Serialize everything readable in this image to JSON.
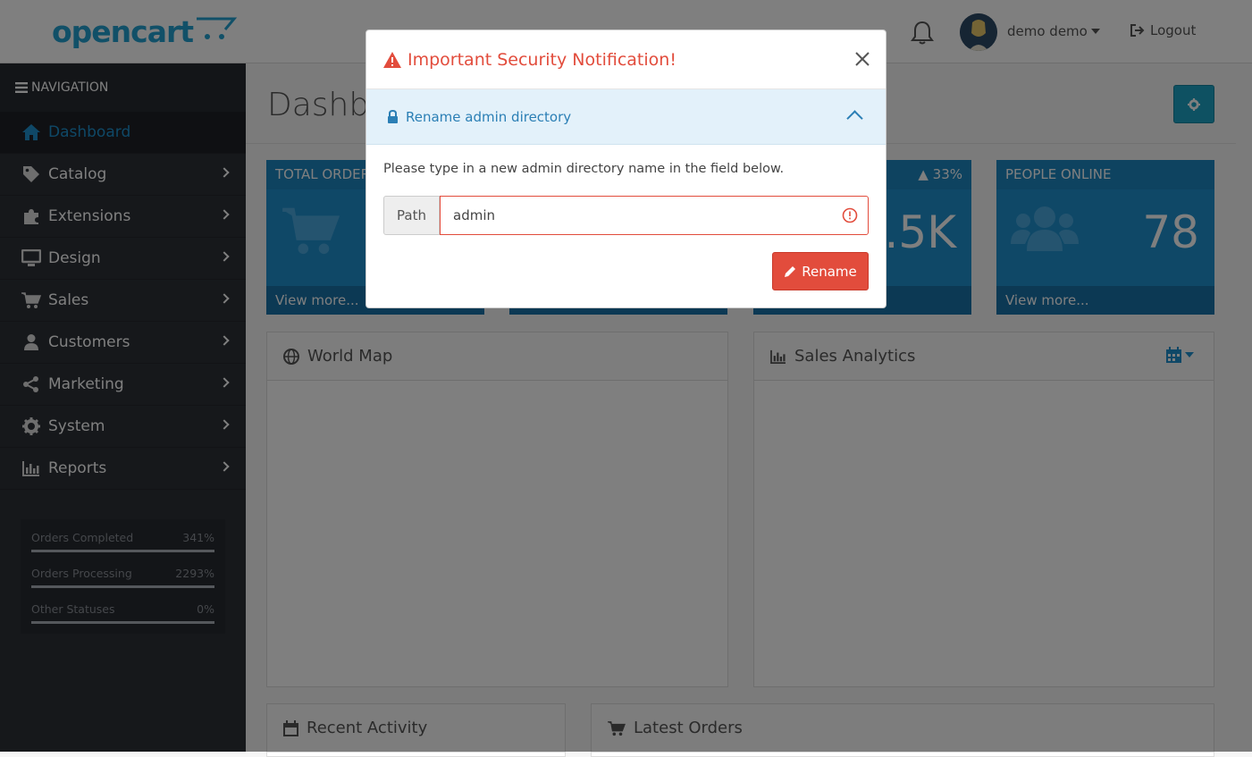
{
  "header": {
    "logo_text": "opencart",
    "user_name": "demo demo",
    "logout_label": "Logout"
  },
  "sidebar": {
    "heading": "NAVIGATION",
    "items": [
      {
        "label": "Dashboard",
        "icon": "home-icon",
        "active": true
      },
      {
        "label": "Catalog",
        "icon": "tag-icon"
      },
      {
        "label": "Extensions",
        "icon": "puzzle-icon"
      },
      {
        "label": "Design",
        "icon": "monitor-icon"
      },
      {
        "label": "Sales",
        "icon": "cart-icon"
      },
      {
        "label": "Customers",
        "icon": "user-icon"
      },
      {
        "label": "Marketing",
        "icon": "share-icon"
      },
      {
        "label": "System",
        "icon": "gear-icon"
      },
      {
        "label": "Reports",
        "icon": "bar-chart-icon"
      }
    ],
    "stats": [
      {
        "label": "Orders Completed",
        "value": "341%"
      },
      {
        "label": "Orders Processing",
        "value": "2293%"
      },
      {
        "label": "Other Statuses",
        "value": "0%"
      }
    ]
  },
  "dashboard": {
    "title": "Dashboard",
    "tiles": [
      {
        "title": "TOTAL ORDERS",
        "change": "",
        "value": "",
        "link": "View more..."
      },
      {
        "title": "",
        "change": "",
        "value": "",
        "link": ""
      },
      {
        "title": "",
        "change": "33%",
        "value": ".5K",
        "link": ""
      },
      {
        "title": "PEOPLE ONLINE",
        "change": "",
        "value": "78",
        "link": "View more..."
      }
    ],
    "panels": {
      "world_map": "World Map",
      "sales_analytics": "Sales Analytics",
      "recent_activity": "Recent Activity",
      "latest_orders": "Latest Orders"
    }
  },
  "modal": {
    "title": "Important Security Notification!",
    "section_title": "Rename admin directory",
    "body_text": "Please type in a new admin directory name in the field below.",
    "path_label": "Path",
    "path_value": "admin",
    "rename_label": "Rename"
  },
  "colors": {
    "brand": "#1e91cf",
    "danger": "#e24c3c",
    "sidebar": "#2c3037"
  }
}
